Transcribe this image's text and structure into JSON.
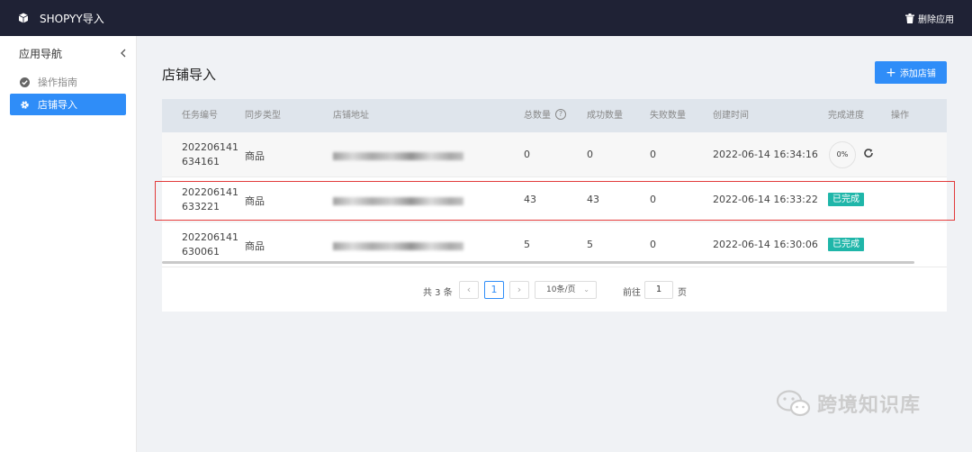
{
  "app": {
    "title": "SHOPYY导入",
    "delete_app_label": "删除应用"
  },
  "sidebar": {
    "heading": "应用导航",
    "items": [
      {
        "label": "操作指南",
        "icon": "check-circle-icon",
        "active": false
      },
      {
        "label": "店铺导入",
        "icon": "gear-icon",
        "active": true
      }
    ]
  },
  "page": {
    "title": "店铺导入",
    "add_store_label": "添加店铺"
  },
  "table": {
    "columns": [
      "任务编号",
      "同步类型",
      "店铺地址",
      "总数量",
      "成功数量",
      "失败数量",
      "创建时间",
      "完成进度",
      "操作"
    ],
    "rows": [
      {
        "id_line1": "202206141",
        "id_line2": "634161",
        "type": "商品",
        "address": "",
        "total": "0",
        "success": "0",
        "failed": "0",
        "created": "2022-06-14 16:34:16",
        "progress": "0%",
        "status": ""
      },
      {
        "id_line1": "202206141",
        "id_line2": "633221",
        "type": "商品",
        "address": "",
        "total": "43",
        "success": "43",
        "failed": "0",
        "created": "2022-06-14 16:33:22",
        "progress": "",
        "status": "已完成"
      },
      {
        "id_line1": "202206141",
        "id_line2": "630061",
        "type": "商品",
        "address": "",
        "total": "5",
        "success": "5",
        "failed": "0",
        "created": "2022-06-14 16:30:06",
        "progress": "",
        "status": "已完成"
      }
    ]
  },
  "pagination": {
    "total_text": "共 3 条",
    "current_page": "1",
    "page_size": "10条/页",
    "goto_label": "前往",
    "goto_value": "1",
    "page_suffix": "页"
  },
  "watermark": {
    "text": "跨境知识库"
  },
  "colors": {
    "topbar": "#1f2235",
    "primary": "#2f8df8",
    "success_badge": "#1fb6a9",
    "highlight": "#e23a3a"
  }
}
